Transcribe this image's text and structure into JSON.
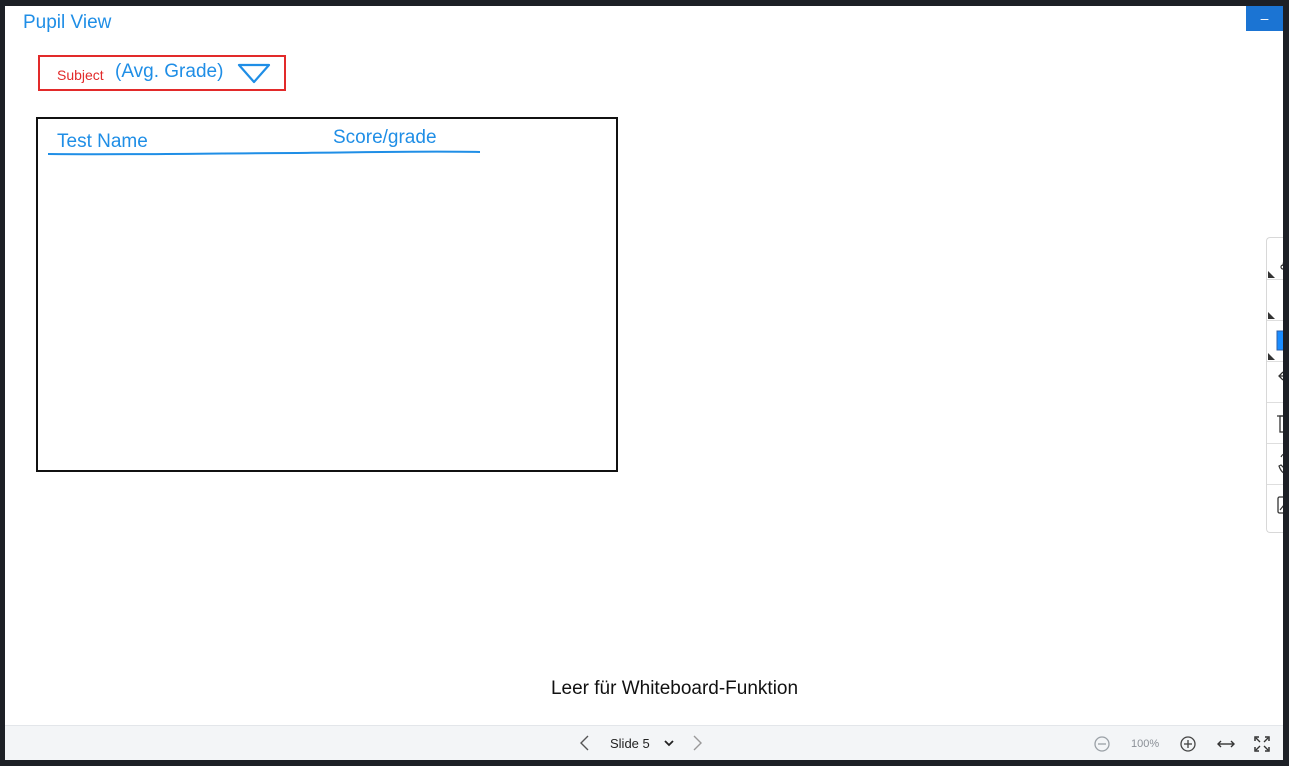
{
  "window": {
    "title": "Pupil View",
    "minimize_label": "–"
  },
  "filter": {
    "subject_label": "Subject",
    "avg_grade_label": "(Avg. Grade)"
  },
  "table": {
    "columns": [
      "Test Name",
      "Score/grade"
    ]
  },
  "caption": "Leer für Whiteboard-Funktion",
  "side_toolbar": {
    "tools": [
      "pen-icon",
      "dot-icon",
      "color-swatch-icon",
      "undo-icon",
      "trash-icon",
      "pan-hand-icon",
      "chart-icon"
    ],
    "swatch_color": "#1a8cff"
  },
  "bottom_bar": {
    "slide_label": "Slide 5",
    "zoom_level": "100%"
  },
  "colors": {
    "accent_blue": "#1f8ee6",
    "alert_red": "#e22a2a",
    "minimize_button": "#1b74d3"
  }
}
